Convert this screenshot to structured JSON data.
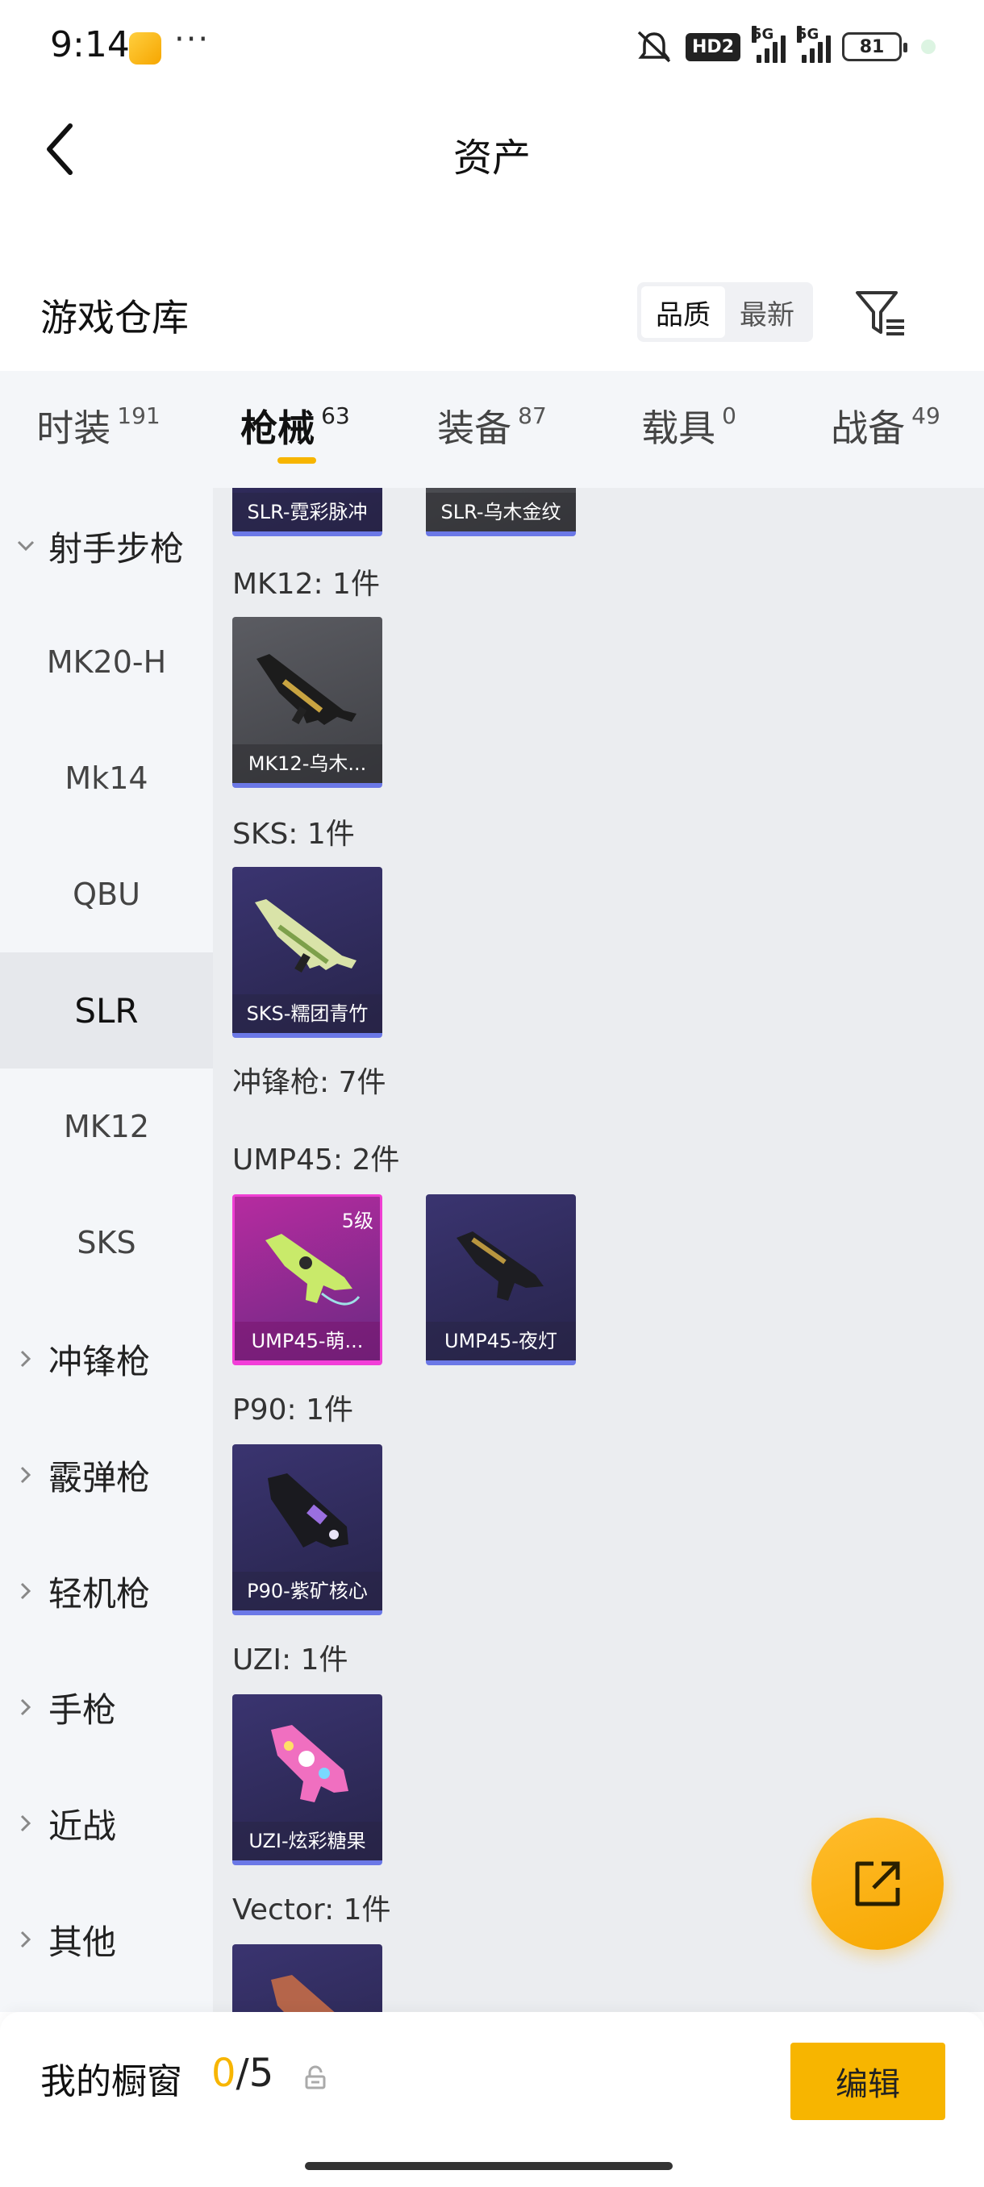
{
  "status_bar": {
    "time": "9:14",
    "dots": "···",
    "hd_label": "HD2",
    "signal1_label": "5G",
    "signal2_label": "5G",
    "battery": "81"
  },
  "header": {
    "title": "资产"
  },
  "section": {
    "title": "游戏仓库",
    "sort_options": [
      "品质",
      "最新"
    ],
    "active_sort": "品质"
  },
  "tabs": [
    {
      "label": "时装",
      "count": "191"
    },
    {
      "label": "枪械",
      "count": "63",
      "active": true
    },
    {
      "label": "装备",
      "count": "87"
    },
    {
      "label": "载具",
      "count": "0"
    },
    {
      "label": "战备",
      "count": "49"
    }
  ],
  "sidebar": {
    "items": [
      {
        "label": "射手步枪",
        "type": "parent",
        "expanded": true
      },
      {
        "label": "MK20-H"
      },
      {
        "label": "Mk14"
      },
      {
        "label": "QBU"
      },
      {
        "label": "SLR",
        "active": true
      },
      {
        "label": "MK12"
      },
      {
        "label": "SKS"
      },
      {
        "label": "冲锋枪",
        "type": "parent"
      },
      {
        "label": "霰弹枪",
        "type": "parent"
      },
      {
        "label": "轻机枪",
        "type": "parent"
      },
      {
        "label": "手枪",
        "type": "parent"
      },
      {
        "label": "近战",
        "type": "parent"
      },
      {
        "label": "其他",
        "type": "parent"
      }
    ]
  },
  "content": {
    "top_cards": [
      {
        "name": "SLR-霓彩脉冲"
      },
      {
        "name": "SLR-乌木金纹"
      }
    ],
    "mk12_label": "MK12: 1件",
    "mk12_cards": [
      {
        "name": "MK12-乌木..."
      }
    ],
    "sks_label": "SKS: 1件",
    "sks_cards": [
      {
        "name": "SKS-糯团青竹"
      }
    ],
    "smg_label": "冲锋枪: 7件",
    "ump_label": "UMP45: 2件",
    "ump_cards": [
      {
        "name": "UMP45-萌...",
        "level": "5级"
      },
      {
        "name": "UMP45-夜灯"
      }
    ],
    "p90_label": "P90: 1件",
    "p90_cards": [
      {
        "name": "P90-紫矿核心"
      }
    ],
    "uzi_label": "UZI: 1件",
    "uzi_cards": [
      {
        "name": "UZI-炫彩糖果"
      }
    ],
    "vector_label": "Vector: 1件"
  },
  "bottom": {
    "showcase_label": "我的橱窗",
    "current": "0",
    "separator": "/",
    "total": "5",
    "edit_label": "编辑"
  },
  "colors": {
    "accent": "#f7b500",
    "rare_border": "#6b78e6",
    "legendary_border": "#f23dd8"
  }
}
